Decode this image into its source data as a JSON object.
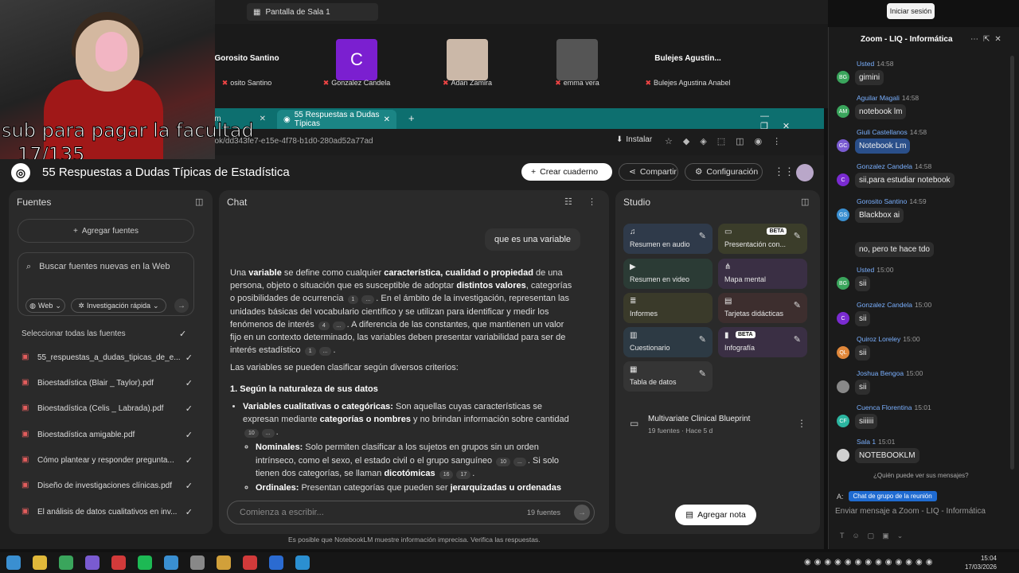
{
  "zoom_meeting": {
    "window_tab": "Pantalla de Sala 1",
    "login": "Iniciar sesión",
    "tiles": [
      {
        "display": "Gorosito Santino",
        "label": "osito Santino",
        "avatar": ""
      },
      {
        "display": "",
        "label": "Gonzalez Candela",
        "avatar": "C"
      },
      {
        "display": "",
        "label": "Adan Zamira",
        "avatar": ""
      },
      {
        "display": "",
        "label": "emma vera",
        "avatar": ""
      },
      {
        "display": "Bulejes  Agustin...",
        "label": "Bulejes Agustina Anabel",
        "avatar": ""
      }
    ]
  },
  "stream_overlay": {
    "line1": "sub para pagar la facultad",
    "line2": "17/135"
  },
  "browser": {
    "tab_prev": "om",
    "tab_active": "55 Respuestas a Dudas Típicas",
    "url": "notebooklm.google.com/notebook/dd343fe7-e15e-4f78-b1d0-280ad52a77ad",
    "install": "Instalar"
  },
  "notebook": {
    "title": "55 Respuestas a Dudas Típicas de Estadística",
    "create": "Crear cuaderno",
    "share": "Compartir",
    "settings": "Configuración"
  },
  "sources": {
    "heading": "Fuentes",
    "add": "Agregar fuentes",
    "search_placeholder": "Buscar fuentes nuevas en la Web",
    "web": "Web",
    "research": "Investigación rápida",
    "select_all": "Seleccionar todas las fuentes",
    "items": [
      "55_respuestas_a_dudas_tipicas_de_e...",
      "Bioestadística (Blair _ Taylor).pdf",
      "Bioestadística (Celis _ Labrada).pdf",
      "Bioestadística amigable.pdf",
      "Cómo plantear y responder pregunta...",
      "Diseño de investigaciones clínicas.pdf",
      "El análisis de datos cualitativos en inv..."
    ]
  },
  "chat": {
    "heading": "Chat",
    "question": "que es una variable",
    "p1_a": "Una ",
    "p1_b": "variable",
    "p1_c": " se define como cualquier ",
    "p1_d": "característica, cualidad o propiedad",
    "p1_e": " de una persona, objeto o situación que es susceptible de adoptar ",
    "p1_f": "distintos valores",
    "p1_g": ", categorías o posibilidades de ocurrencia ",
    "p1_h": ". En el ámbito de la investigación, representan las unidades básicas del vocabulario científico y se utilizan para identificar y medir los fenómenos de interés ",
    "p1_i": ". A diferencia de las constantes, que mantienen un valor fijo en un contexto determinado, las variables deben presentar variabilidad para ser de interés estadístico ",
    "p2": "Las variables se pueden clasificar según diversos criterios:",
    "h1": "1. Según la naturaleza de sus datos",
    "li1_b": "Variables cualitativas o categóricas:",
    "li1_t": " Son aquellas cuyas características se expresan mediante ",
    "li1_b2": "categorías o nombres",
    "li1_t2": " y no brindan información sobre cantidad",
    "li2_b": "Nominales:",
    "li2_t": " Solo permiten clasificar a los sujetos en grupos sin un orden intrínseco, como el sexo, el estado civil o el grupo sanguíneo ",
    "li2_t2": ". Si solo tienen dos categorías, se llaman ",
    "li2_b2": "dicotómicas",
    "li3_b": "Ordinales:",
    "li3_t": " Presentan categorías que pueden ser ",
    "li3_b2": "jerarquizadas u ordenadas",
    "cites": [
      "1",
      "...",
      "4",
      "...",
      "1",
      "...",
      "10",
      "...",
      "10",
      "...",
      "16",
      "17"
    ],
    "input_placeholder": "Comienza a escribir...",
    "source_count": "19 fuentes",
    "disclaimer": "Es posible que NotebookLM muestre información imprecisa. Verifica las respuestas."
  },
  "studio": {
    "heading": "Studio",
    "cards": [
      {
        "label": "Resumen en audio",
        "color": "#2f3a4a"
      },
      {
        "label": "Presentación con...",
        "color": "#3b3d2a",
        "beta": "BETA"
      },
      {
        "label": "Resumen en video",
        "color": "#2b3b35"
      },
      {
        "label": "Mapa mental",
        "color": "#3a2f44"
      },
      {
        "label": "Informes",
        "color": "#3a3a2a"
      },
      {
        "label": "Tarjetas didácticas",
        "color": "#3d2e2e"
      },
      {
        "label": "Cuestionario",
        "color": "#2d3a44"
      },
      {
        "label": "Infografía",
        "color": "#3a2f44",
        "beta": "BETA"
      },
      {
        "label": "Tabla de datos",
        "color": "#353535"
      }
    ],
    "note_title": "Multivariate Clinical Blueprint",
    "note_meta": "19 fuentes · Hace 5 d",
    "add_note": "Agregar nota"
  },
  "zoom_chat": {
    "title": "Zoom - LIQ - Informática",
    "messages": [
      {
        "who": "Usted",
        "time": "14:58",
        "text": "gimini",
        "init": "BG",
        "color": "#3aa55c"
      },
      {
        "who": "Aguilar Magali",
        "time": "14:58",
        "text": "notebook lm",
        "init": "AM",
        "color": "#3aa55c"
      },
      {
        "who": "Giuli Castellanos",
        "time": "14:58",
        "text": "Notebook Lm",
        "init": "GC",
        "color": "#7a5bd1"
      },
      {
        "who": "Gonzalez Candela",
        "time": "14:58",
        "text": "sii,para estudiar notebook",
        "init": "C",
        "color": "#7a2bd1"
      },
      {
        "who": "Gorosito Santino",
        "time": "14:59",
        "text": "Blackbox ai",
        "init": "GS",
        "color": "#3a8fd1"
      },
      {
        "who": "",
        "time": "",
        "text": "no, pero te hace tdo",
        "init": "",
        "color": ""
      },
      {
        "who": "Usted",
        "time": "15:00",
        "text": "sii",
        "init": "BG",
        "color": "#3aa55c"
      },
      {
        "who": "Gonzalez Candela",
        "time": "15:00",
        "text": "sii",
        "init": "C",
        "color": "#7a2bd1"
      },
      {
        "who": "Quiroz Loreley",
        "time": "15:00",
        "text": "sii",
        "init": "QL",
        "color": "#e0873a"
      },
      {
        "who": "Joshua Bengoa",
        "time": "15:00",
        "text": "sii",
        "init": "",
        "color": "#888"
      },
      {
        "who": "Cuenca Florentina",
        "time": "15:01",
        "text": "siiiiii",
        "init": "CF",
        "color": "#2bb5a0"
      },
      {
        "who": "Sala 1",
        "time": "15:01",
        "text": "NOTEBOOKLM",
        "init": "",
        "color": "#d0d0d0"
      }
    ],
    "who_sees": "¿Quién puede ver sus mensajes?",
    "to_label": "A:",
    "to_chip": "Chat de grupo de la reunión",
    "input_placeholder": "Enviar mensaje a Zoom - LIQ - Informática"
  },
  "taskbar": {
    "time": "15:04",
    "date": "17/03/2026"
  }
}
